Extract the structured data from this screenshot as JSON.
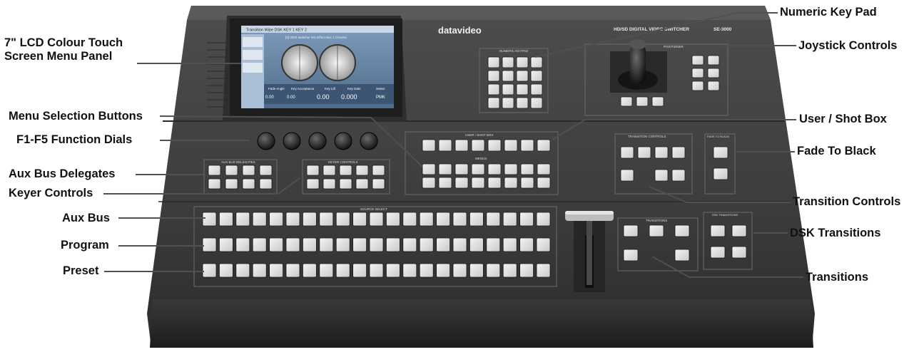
{
  "panel": {
    "brand": "datavideo",
    "model_title": "HD/SD DIGITAL VIDEO SWITCHER",
    "model_number": "SE-3000",
    "lcd": {
      "header": "Transition   Wipe   DSK   KEY 1   KEY 2",
      "effect_line": "[0] 0000 Switcher Mix Effect Bus 1 Chroma",
      "params": [
        "Fade Angle",
        "Key Acceptance",
        "Key Lift",
        "Key Gain",
        "Select"
      ],
      "values": [
        "0.00",
        "0.00",
        "0.00",
        "0.000",
        "PMK"
      ]
    },
    "section_labels": {
      "aux_bus_delegates": "AUX BUS DELEGATES",
      "keyer_controls": "KEYER CONTROLS",
      "user_shot_box": "USER / SHOT BOX",
      "menus": "MENUS",
      "source_select": "SOURCE SELECT",
      "transition_controls": "TRANSITION CONTROLS",
      "fade_to_black": "FADE TO BLACK",
      "transitions": "TRANSITIONS",
      "dsk_transitions": "DSK TRANSITIONS",
      "numeric_keypad": "NUMERIC KEYPAD",
      "joystick": "POSITIONER"
    }
  },
  "callouts": {
    "lcd_line1": "7\" LCD Colour Touch",
    "lcd_line2": "Screen Menu Panel",
    "menu_selection": "Menu Selection Buttons",
    "function_dials": "F1-F5 Function Dials",
    "aux_bus_delegates": "Aux Bus Delegates",
    "keyer_controls": "Keyer Controls",
    "aux_bus": "Aux Bus",
    "program": "Program",
    "preset": "Preset",
    "numeric_keypad": "Numeric Key Pad",
    "joystick_controls": "Joystick Controls",
    "user_shot_box": "User / Shot Box",
    "fade_to_black": "Fade To Black",
    "transition_controls": "Transition Controls",
    "dsk_transitions": "DSK Transitions",
    "transitions": "Transitions"
  },
  "colors": {
    "panel_body": "#3d3d3d",
    "panel_top": "#4a4a4a",
    "button_face": "#e4e4e4",
    "screen_blue": "#6f8fb0",
    "label_text": "#111111",
    "leader_line": "#555555"
  }
}
